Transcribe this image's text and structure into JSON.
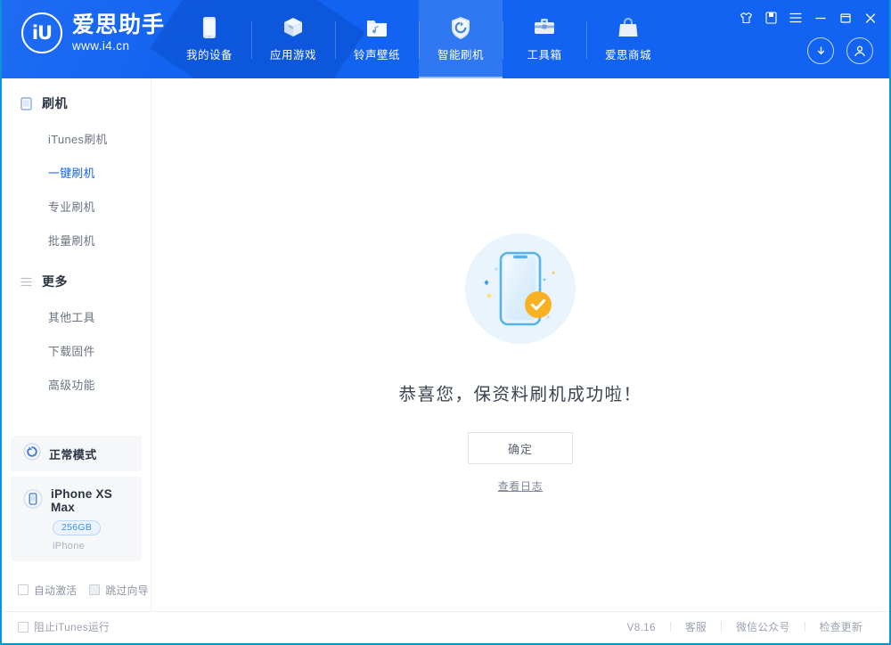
{
  "brand": {
    "logo_text": "iU",
    "name": "爱思助手",
    "url": "www.i4.cn"
  },
  "header": {
    "nav": [
      {
        "label": "我的设备",
        "icon": "phone-icon",
        "active": false
      },
      {
        "label": "应用游戏",
        "icon": "cube-icon",
        "active": false
      },
      {
        "label": "铃声壁纸",
        "icon": "music-folder-icon",
        "active": false
      },
      {
        "label": "智能刷机",
        "icon": "shield-refresh-icon",
        "active": true
      },
      {
        "label": "工具箱",
        "icon": "toolbox-icon",
        "active": false
      },
      {
        "label": "爱思商城",
        "icon": "shop-bag-icon",
        "active": false
      }
    ],
    "window_buttons": [
      {
        "name": "skin-icon",
        "glyph": "♡"
      },
      {
        "name": "message-icon",
        "glyph": "▯"
      },
      {
        "name": "menu-icon",
        "glyph": "≡"
      },
      {
        "name": "minimize-icon",
        "glyph": "—"
      },
      {
        "name": "maximize-icon",
        "glyph": "❐"
      },
      {
        "name": "close-icon",
        "glyph": "✕"
      }
    ],
    "round_buttons": [
      {
        "name": "download-icon"
      },
      {
        "name": "account-icon"
      }
    ],
    "accent_color": "#1263f1"
  },
  "sidebar": {
    "groups": [
      {
        "label": "刷机",
        "icon": "phone-outline-icon",
        "items": [
          {
            "label": "iTunes刷机",
            "active": false
          },
          {
            "label": "一键刷机",
            "active": true
          },
          {
            "label": "专业刷机",
            "active": false
          },
          {
            "label": "批量刷机",
            "active": false
          }
        ]
      },
      {
        "label": "更多",
        "icon": "hamburger-icon",
        "items": [
          {
            "label": "其他工具",
            "active": false
          },
          {
            "label": "下载固件",
            "active": false
          },
          {
            "label": "高级功能",
            "active": false
          }
        ]
      }
    ],
    "mode_card": {
      "label": "正常模式",
      "icon": "refresh-circle-icon"
    },
    "device_card": {
      "name": "iPhone XS Max",
      "capacity": "256GB",
      "type": "iPhone",
      "icon": "device-phone-icon"
    },
    "checkboxes": [
      {
        "label": "自动激活",
        "checked": false
      },
      {
        "label": "跳过向导",
        "checked": false
      }
    ]
  },
  "main": {
    "illustration": "phone-success-illustration",
    "title": "恭喜您，保资料刷机成功啦！",
    "confirm_label": "确定",
    "log_link_label": "查看日志"
  },
  "footer": {
    "block_itunes_label": "阻止iTunes运行",
    "block_itunes_checked": false,
    "version": "V8.16",
    "links": [
      {
        "label": "客服"
      },
      {
        "label": "微信公众号"
      },
      {
        "label": "检查更新"
      }
    ]
  }
}
